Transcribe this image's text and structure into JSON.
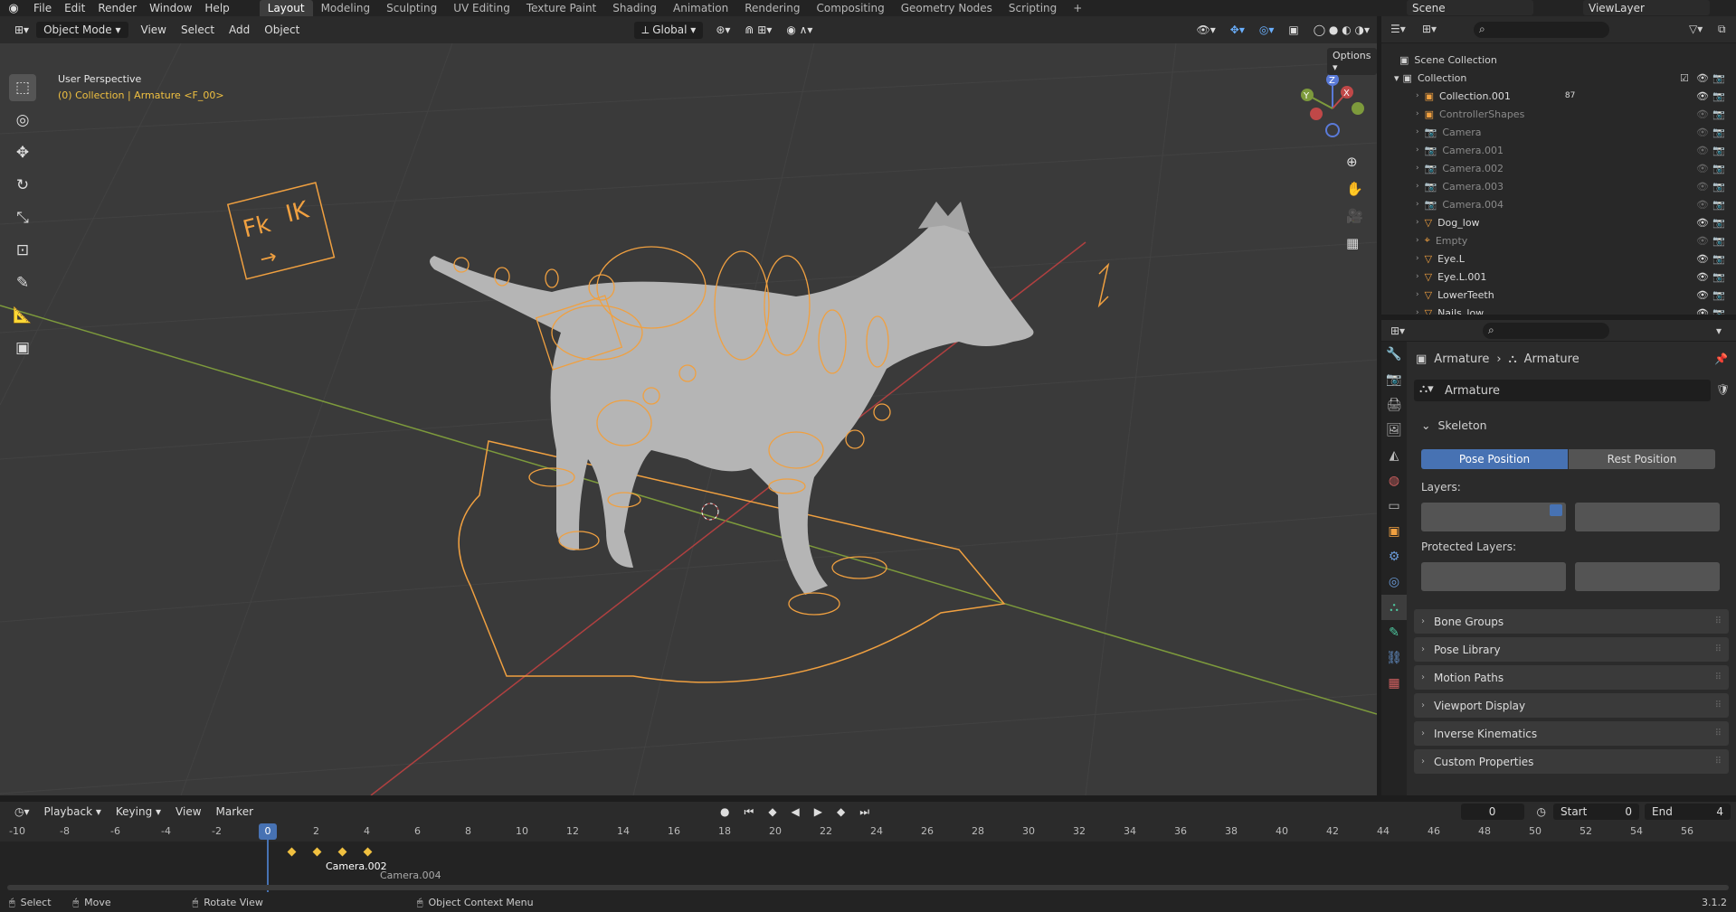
{
  "topbar": {
    "menus": [
      "File",
      "Edit",
      "Render",
      "Window",
      "Help"
    ],
    "workspaces": [
      "Layout",
      "Modeling",
      "Sculpting",
      "UV Editing",
      "Texture Paint",
      "Shading",
      "Animation",
      "Rendering",
      "Compositing",
      "Geometry Nodes",
      "Scripting"
    ],
    "active_workspace": "Layout",
    "add_tab": "+",
    "scene": "Scene",
    "view_layer": "ViewLayer"
  },
  "viewport_header": {
    "mode": "Object Mode",
    "menus": [
      "View",
      "Select",
      "Add",
      "Object"
    ],
    "orientation": "Global",
    "options": "Options"
  },
  "viewport": {
    "perspective": "User Perspective",
    "context": "(0) Collection | Armature <F_00>",
    "fkik_label_fk": "Fk",
    "fkik_label_ik": "IK",
    "fkik_arrow": "→",
    "gizmo": {
      "x": "X",
      "y": "Y",
      "z": "Z"
    },
    "colors": {
      "bg": "#3a3a3a",
      "bone": "#f0a040",
      "x_axis": "#c04848",
      "y_axis": "#8ab040"
    }
  },
  "outliner": {
    "root": "Scene Collection",
    "collection": "Collection",
    "items": [
      {
        "name": "Collection.001",
        "badge": "87"
      },
      {
        "name": "ControllerShapes"
      },
      {
        "name": "Camera"
      },
      {
        "name": "Camera.001"
      },
      {
        "name": "Camera.002"
      },
      {
        "name": "Camera.003"
      },
      {
        "name": "Camera.004"
      },
      {
        "name": "Dog_low"
      },
      {
        "name": "Empty"
      },
      {
        "name": "Eye.L"
      },
      {
        "name": "Eye.L.001"
      },
      {
        "name": "LowerTeeth"
      },
      {
        "name": "Nails_low"
      }
    ]
  },
  "properties": {
    "breadcrumb_object": "Armature",
    "breadcrumb_data": "Armature",
    "datablock_name": "Armature",
    "skeleton_panel": "Skeleton",
    "pose_position": "Pose Position",
    "rest_position": "Rest Position",
    "layers_label": "Layers:",
    "protected_layers_label": "Protected Layers:",
    "panels": [
      "Bone Groups",
      "Pose Library",
      "Motion Paths",
      "Viewport Display",
      "Inverse Kinematics",
      "Custom Properties"
    ]
  },
  "timeline": {
    "menus": [
      "Playback",
      "Keying",
      "View",
      "Marker"
    ],
    "current_frame": "0",
    "start_label": "Start",
    "start_value": "0",
    "end_label": "End",
    "end_value": "4",
    "ticks": [
      "-10",
      "-8",
      "-6",
      "-4",
      "-2",
      "0",
      "2",
      "4",
      "6",
      "8",
      "10",
      "12",
      "14",
      "16",
      "18",
      "20",
      "22",
      "24",
      "26",
      "28",
      "30",
      "32",
      "34",
      "36",
      "38",
      "40",
      "42",
      "44",
      "46",
      "48",
      "50",
      "52",
      "54",
      "56"
    ],
    "marker_labels": [
      "Camera.002",
      "Camera.004"
    ]
  },
  "statusbar": {
    "select": "Select",
    "move": "Move",
    "rotate": "Rotate View",
    "context_menu": "Object Context Menu",
    "version": "3.1.2"
  }
}
